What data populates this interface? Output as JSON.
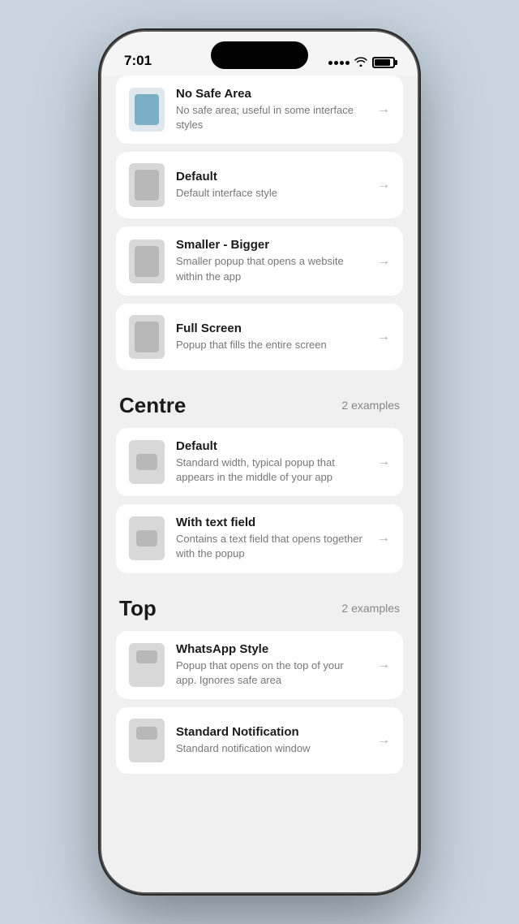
{
  "status": {
    "time": "7:01"
  },
  "sections": [
    {
      "id": "top-section-partial",
      "title": null,
      "count": null,
      "items": [
        {
          "id": "no-safe-area",
          "title": "No Safe Area",
          "desc": "No safe area; useful in some interface styles",
          "iconStyle": "blue-top"
        },
        {
          "id": "default",
          "title": "Default",
          "desc": "Default interface style",
          "iconStyle": "default"
        },
        {
          "id": "smaller-bigger",
          "title": "Smaller - Bigger",
          "desc": "Smaller popup that opens a website within the app",
          "iconStyle": "default"
        },
        {
          "id": "full-screen",
          "title": "Full Screen",
          "desc": "Popup that fills the entire screen",
          "iconStyle": "default"
        }
      ]
    },
    {
      "id": "centre",
      "title": "Centre",
      "count": "2 examples",
      "items": [
        {
          "id": "centre-default",
          "title": "Default",
          "desc": "Standard width, typical popup that appears in the middle of your app",
          "iconStyle": "centre"
        },
        {
          "id": "with-text-field",
          "title": "With text field",
          "desc": "Contains a text field that opens together with the popup",
          "iconStyle": "centre-text"
        }
      ]
    },
    {
      "id": "top",
      "title": "Top",
      "count": "2 examples",
      "items": [
        {
          "id": "whatsapp-style",
          "title": "WhatsApp Style",
          "desc": "Popup that opens on the top of your app. Ignores safe area",
          "iconStyle": "top-style"
        },
        {
          "id": "standard-notification",
          "title": "Standard Notification",
          "desc": "Standard notification window",
          "iconStyle": "top-style"
        }
      ]
    }
  ]
}
